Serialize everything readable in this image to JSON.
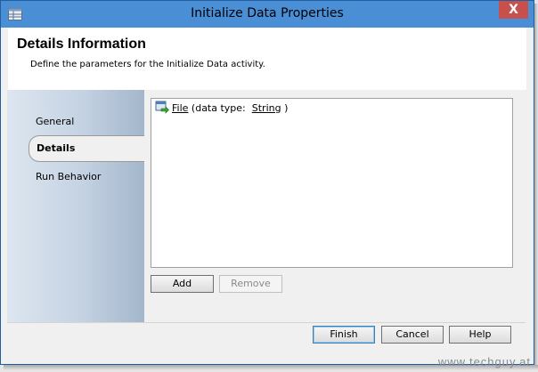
{
  "window": {
    "title": "Initialize Data Properties",
    "close_glyph": "X"
  },
  "header": {
    "title": "Details Information",
    "subtitle": "Define the parameters for the Initialize Data activity."
  },
  "sidebar": {
    "items": [
      {
        "label": "General",
        "active": false
      },
      {
        "label": "Details",
        "active": true
      },
      {
        "label": "Run Behavior",
        "active": false
      }
    ]
  },
  "parameters": [
    {
      "name": "File",
      "prefix": "(data type:",
      "type": "String",
      "suffix": ")"
    }
  ],
  "list_buttons": {
    "add_label": "Add",
    "remove_label": "Remove"
  },
  "footer_buttons": {
    "finish_label": "Finish",
    "cancel_label": "Cancel",
    "help_label": "Help"
  },
  "watermark": "www.techguy.at",
  "colors": {
    "titlebar": "#4a8fd6",
    "close": "#c74f4c",
    "window_bg": "#f0f0f0"
  }
}
